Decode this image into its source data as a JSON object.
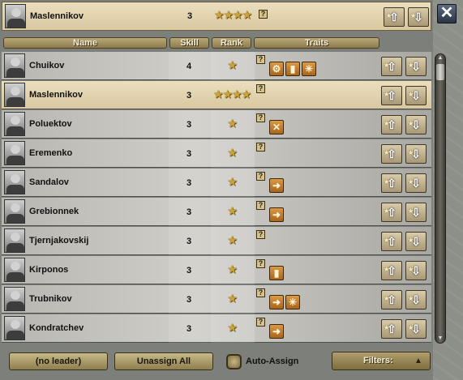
{
  "selected": {
    "name": "Maslennikov",
    "skill": "3",
    "rank": "★★★★",
    "traits_help": "?"
  },
  "headers": {
    "name": "Name",
    "skill": "Skill",
    "rank": "Rank",
    "traits": "Traits"
  },
  "leaders": [
    {
      "name": "Chuikov",
      "skill": "4",
      "rank": "★",
      "traits": [
        "gear-trait",
        "shield-trait",
        "snow-trait"
      ],
      "selected": false
    },
    {
      "name": "Maslennikov",
      "skill": "3",
      "rank": "★★★★",
      "traits": [],
      "selected": true
    },
    {
      "name": "Poluektov",
      "skill": "3",
      "rank": "★",
      "traits": [
        "crossed-swords-trait"
      ],
      "selected": false
    },
    {
      "name": "Eremenko",
      "skill": "3",
      "rank": "★",
      "traits": [],
      "selected": false
    },
    {
      "name": "Sandalov",
      "skill": "3",
      "rank": "★",
      "traits": [
        "arrow-trait"
      ],
      "selected": false
    },
    {
      "name": "Grebionnek",
      "skill": "3",
      "rank": "★",
      "traits": [
        "arrow-trait"
      ],
      "selected": false
    },
    {
      "name": "Tjernjakovskij",
      "skill": "3",
      "rank": "★",
      "traits": [],
      "selected": false
    },
    {
      "name": "Kirponos",
      "skill": "3",
      "rank": "★",
      "traits": [
        "shield-trait"
      ],
      "selected": false
    },
    {
      "name": "Trubnikov",
      "skill": "3",
      "rank": "★",
      "traits": [
        "arrow-trait",
        "snow-trait"
      ],
      "selected": false
    },
    {
      "name": "Kondratchev",
      "skill": "3",
      "rank": "★",
      "traits": [
        "arrow-trait"
      ],
      "selected": false
    }
  ],
  "icons": {
    "help": "?",
    "promote": "⇧",
    "demote": "⇩",
    "close": "✕",
    "arrow-trait": "➜",
    "gear-trait": "⚙",
    "shield-trait": "▮",
    "snow-trait": "✳",
    "crossed-swords-trait": "✕"
  },
  "bottom": {
    "no_leader": "(no leader)",
    "unassign_all": "Unassign All",
    "auto_assign": "Auto-Assign",
    "filters": "Filters:"
  },
  "colors": {
    "selected_row": "#ecdfbe",
    "trait_bg": "#c98334",
    "header": "#a8966a"
  }
}
